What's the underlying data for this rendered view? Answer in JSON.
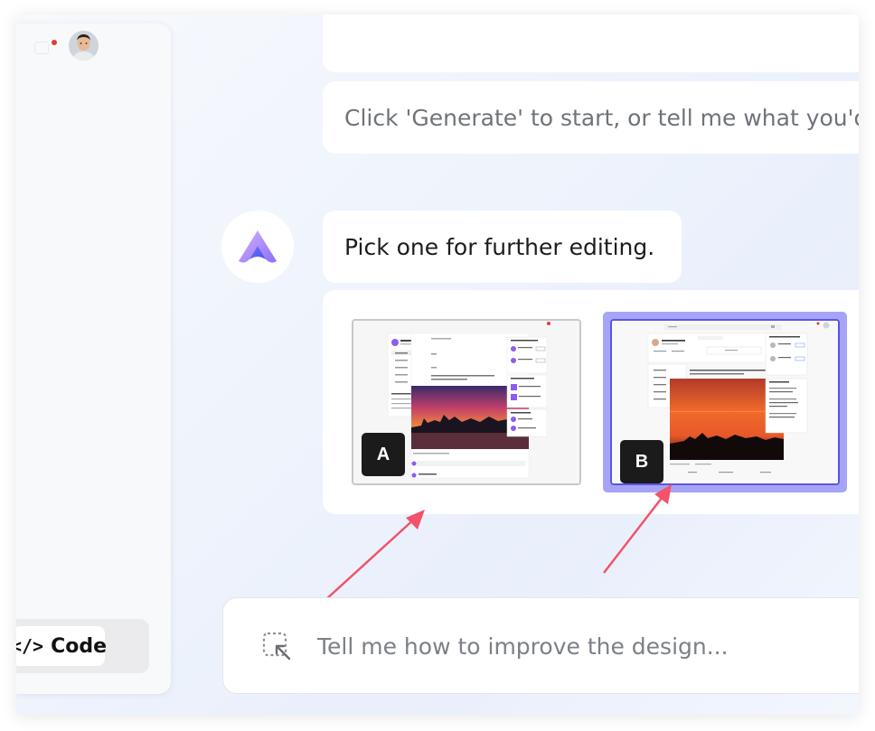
{
  "sidebar": {
    "notification_icon": "bell-icon",
    "has_notification": true,
    "code_toggle": {
      "icon": "code-icon",
      "icon_glyph": "</>",
      "label": "Code"
    }
  },
  "chat": {
    "generate_prompt": "Click 'Generate' to start, or tell me what you'd",
    "pick_message": "Pick one for further editing.",
    "options": [
      {
        "badge": "A",
        "selected": false
      },
      {
        "badge": "B",
        "selected": true
      }
    ]
  },
  "input": {
    "placeholder": "Tell me how to improve the design...",
    "value": "",
    "icon": "select-element-icon"
  },
  "colors": {
    "selection_outer": "#a6a4f8",
    "selection_inner": "#5a55e0",
    "arrow": "#f2536a",
    "notification": "#e53935",
    "logo_gradient_start": "#c39bff",
    "logo_gradient_end": "#4b63f2"
  }
}
